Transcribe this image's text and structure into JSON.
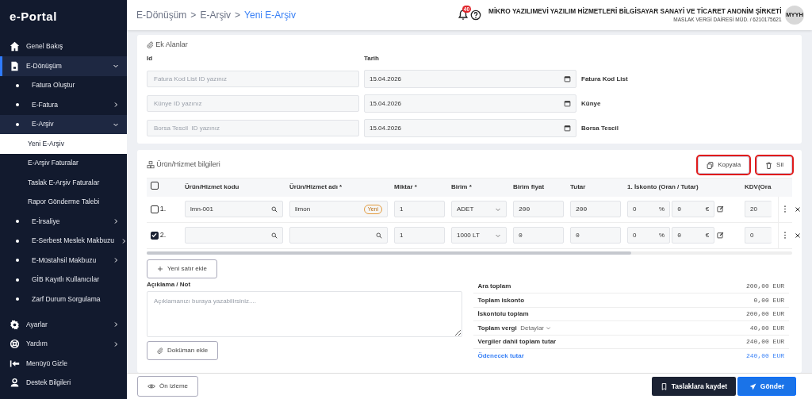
{
  "brand": "e-Portal",
  "sidebar": {
    "items": [
      {
        "label": "Genel Bakış",
        "selected": false
      },
      {
        "label": "E-Dönüşüm",
        "selected": false,
        "expanded": true,
        "children": [
          {
            "label": "Fatura Oluştur",
            "selected": false
          },
          {
            "label": "E-Fatura",
            "selected": false,
            "expanded": false
          },
          {
            "label": "E-Arşiv",
            "selected": false,
            "expanded": true,
            "children": [
              {
                "label": "Yeni E-Arşiv",
                "selected": true
              },
              {
                "label": "E-Arşiv Faturalar",
                "selected": false
              },
              {
                "label": "Taslak E-Arşiv Faturalar",
                "selected": false
              },
              {
                "label": "Rapor Gönderme Talebi",
                "selected": false
              }
            ]
          },
          {
            "label": "E-İrsaliye",
            "selected": false,
            "expanded": false
          },
          {
            "label": "E-Serbest Meslek Makbuzu",
            "selected": false,
            "expanded": false
          },
          {
            "label": "E-Müstahsil Makbuzu",
            "selected": false,
            "expanded": false
          },
          {
            "label": "GİB Kayıtlı Kullanıcılar",
            "selected": false
          },
          {
            "label": "Zarf Durum Sorgulama",
            "selected": false
          }
        ]
      }
    ],
    "bottom_items": [
      {
        "label": "Ayarlar",
        "selected": false,
        "expanded": false
      },
      {
        "label": "Yardım",
        "selected": false,
        "expanded": false
      },
      {
        "label": "Menüyü Gizle",
        "selected": false
      },
      {
        "label": "Destek Bilgileri",
        "selected": false
      }
    ]
  },
  "breadcrumb": [
    {
      "label": "E-Dönüşüm",
      "selected": false
    },
    {
      "label": "E-Arşiv",
      "selected": false
    },
    {
      "label": "Yeni E-Arşiv",
      "selected": true
    }
  ],
  "breadcrumb_separator": ">",
  "notifications": {
    "count": "40"
  },
  "company": {
    "name": "MİKRO YAZILIMEVİ YAZILIM HİZMETLERİ BİLGİSAYAR SANAYİ VE TİCARET ANONİM ŞİRKETİ",
    "subtitle": "MASLAK VERGİ DAİRESİ MÜD. / 6210175621",
    "avatar": "MYYH"
  },
  "extra_fields": {
    "title": "Ek Alanlar",
    "id_label": "Id",
    "date_label": "Tarih",
    "rows": [
      {
        "placeholder": "Fatura Kod List ID yazınız",
        "date": "15.04.2026",
        "label": "Fatura Kod List"
      },
      {
        "placeholder": "Künye ID yazınız",
        "date": "15.04.2026",
        "label": "Künye"
      },
      {
        "placeholder": "Borsa Tescil  ID yazınız",
        "date": "15.04.2026",
        "label": "Borsa Tescil"
      }
    ]
  },
  "products": {
    "title": "Ürün/Hizmet bilgileri",
    "actions": [
      {
        "label": "Kopyala",
        "highlighted": true
      },
      {
        "label": "Sil",
        "highlighted": true
      }
    ],
    "all_checked": false,
    "columns": [
      "Ürün/Hizmet kodu",
      "Ürün/Hizmet adı *",
      "Miktar *",
      "Birim *",
      "Birim fiyat",
      "Tutar",
      "1. İskonto (Oran / Tutar)",
      "KDV(Ora"
    ],
    "rows": [
      {
        "checked": false,
        "number": "1.",
        "code": "lmn-001",
        "name": "limon",
        "badge": "Yeni",
        "quantity": "1",
        "unit": "ADET",
        "unit_price": "200",
        "total": "200",
        "discount_rate": "0",
        "discount_rate_unit": "%",
        "discount_amount": "0",
        "discount_amount_unit": "€",
        "vat": "20"
      },
      {
        "checked": true,
        "number": "2.",
        "quantity": "1",
        "unit": "1000 LT",
        "unit_price": "0",
        "total": "0",
        "discount_rate": "0",
        "discount_rate_unit": "%",
        "discount_amount": "0",
        "discount_amount_unit": "€",
        "vat": "0"
      }
    ],
    "add_row": "Yeni satır ekle"
  },
  "note": {
    "label": "Açıklama / Not",
    "placeholder": "Açıklamanızı buraya yazabilirsiniz...."
  },
  "attach": "Doküman ekle",
  "totals": [
    {
      "label": "Ara toplam",
      "value": "200,00 EUR"
    },
    {
      "label": "Toplam iskonto",
      "value": "0,00 EUR"
    },
    {
      "label": "İskontolu toplam",
      "value": "200,00 EUR"
    },
    {
      "label": "Toplam vergi",
      "detail": "Detaylar",
      "value": "40,00 EUR"
    },
    {
      "label": "Vergiler dahil toplam tutar",
      "value": "240,00 EUR"
    },
    {
      "label": "Ödenecek tutar",
      "value": "240,00 EUR",
      "kind": "payable"
    }
  ],
  "footer": {
    "preview": "Ön izleme",
    "save_draft": "Taslaklara kaydet",
    "send": "Gönder"
  }
}
